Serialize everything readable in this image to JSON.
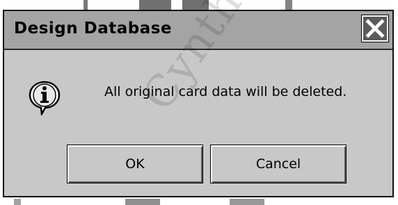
{
  "dialog": {
    "title": "Design Database",
    "close_icon": "close-x-icon",
    "message_icon": "info-icon",
    "message": "All original card data will be deleted.",
    "ok_label": "OK",
    "cancel_label": "Cancel"
  },
  "watermark": {
    "text": "Cynthi"
  },
  "colors": {
    "titlebar": "#a4a4a4",
    "body": "#c8c8c8",
    "close_button": "#5b5b5b"
  }
}
